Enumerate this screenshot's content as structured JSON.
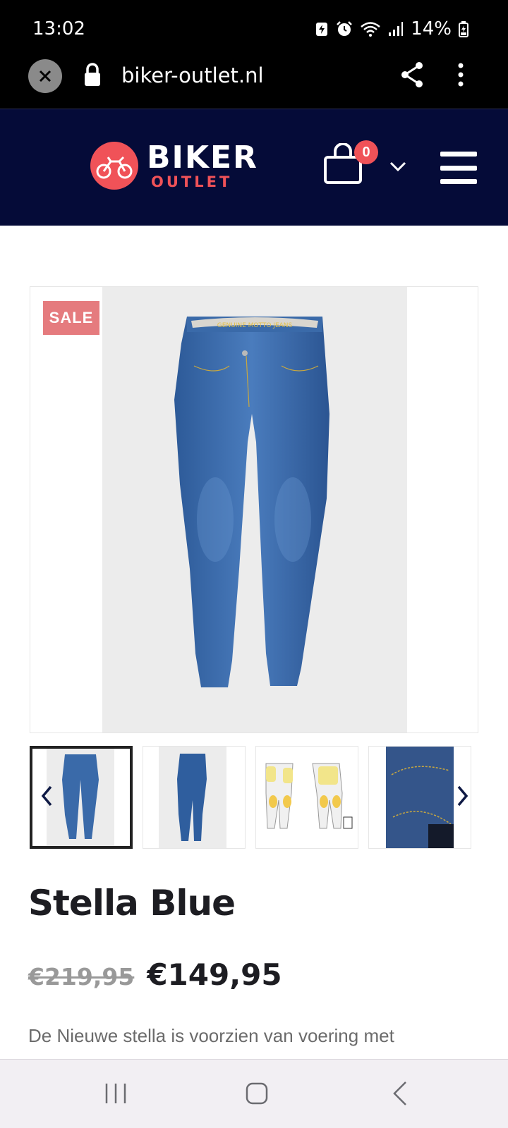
{
  "status_bar": {
    "time": "13:02",
    "battery": "14%",
    "icons": [
      "battery-saver-icon",
      "alarm-icon",
      "wifi-icon",
      "signal-icon",
      "charging-battery-icon"
    ]
  },
  "browser": {
    "url": "biker-outlet.nl",
    "icons": [
      "close-icon",
      "lock-icon",
      "share-icon",
      "more-vert-icon"
    ]
  },
  "header": {
    "logo_primary": "BIKER",
    "logo_secondary": "OUTLET",
    "cart_count": "0",
    "colors": {
      "background": "#050b38",
      "accent": "#f05258"
    }
  },
  "product": {
    "badge": "SALE",
    "title": "Stella Blue",
    "price_old": "€219,95",
    "price_new": "€149,95",
    "description": "De Nieuwe stella is voorzien van voering met",
    "waistband_text": "GENUINE MOTTO JEANS",
    "thumbnails": [
      "jeans-front",
      "jeans-side",
      "armor-diagram",
      "fabric-closeup"
    ],
    "active_thumbnail": 0
  },
  "navigation": {
    "icons": [
      "recents-icon",
      "home-icon",
      "back-icon"
    ]
  }
}
